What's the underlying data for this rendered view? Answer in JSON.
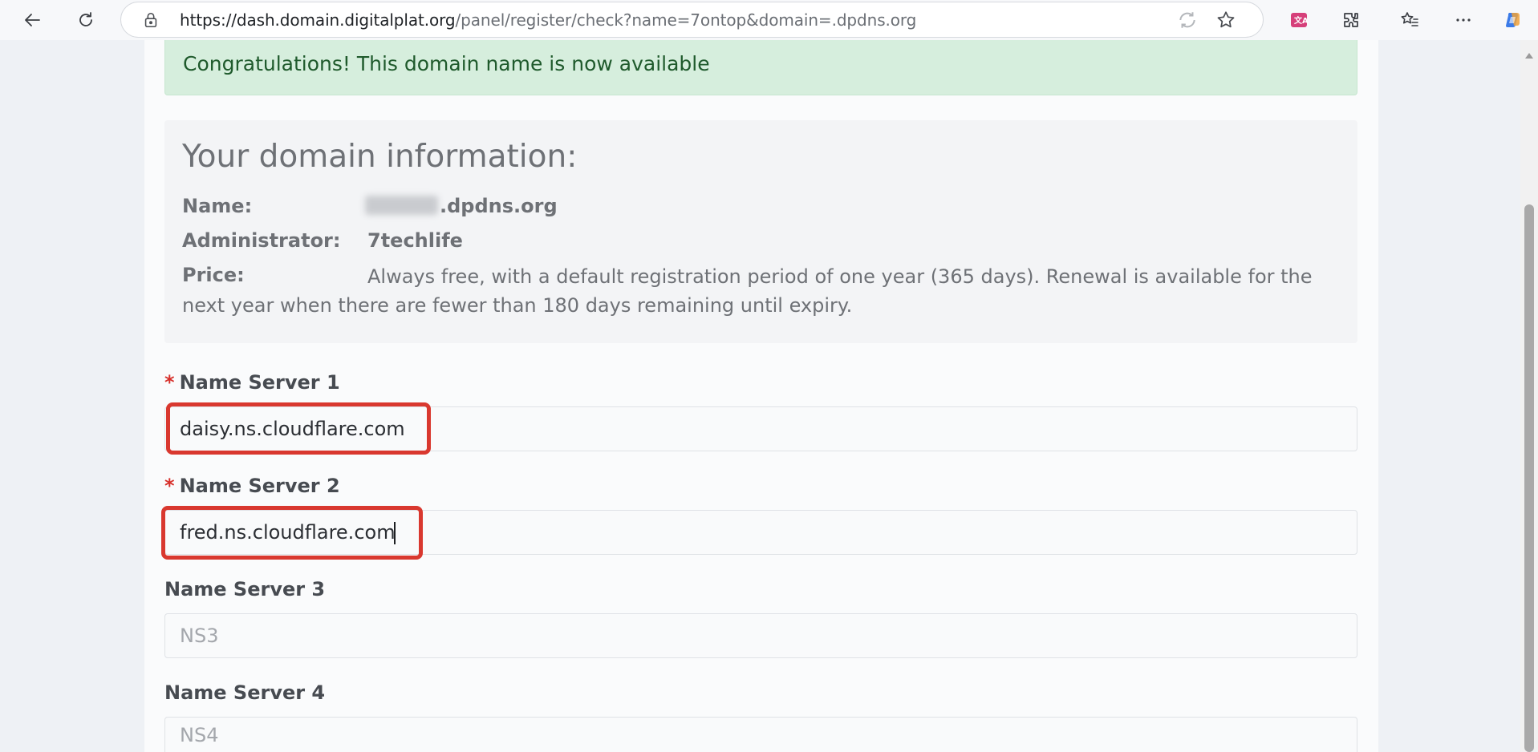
{
  "browser": {
    "url_host": "https://dash.domain.digitalplat.org",
    "url_path": "/panel/register/check?name=7ontop&domain=.dpdns.org",
    "icons": [
      "back-icon",
      "refresh-icon",
      "lock-icon",
      "tracking-prevention-icon",
      "favorite-star-icon",
      "translate-icon",
      "extensions-icon",
      "favorites-list-icon",
      "more-icon",
      "copilot-icon"
    ]
  },
  "alert": {
    "message": "Congratulations! This domain name is now available"
  },
  "domain_info": {
    "title": "Your domain information:",
    "name_label": "Name:",
    "name_suffix": ".dpdns.org",
    "admin_label": "Administrator:",
    "admin_value": "7techlife",
    "price_label": "Price:",
    "price_value": "Always free, with a default registration period of one year (365 days). Renewal is available for the next year when there are fewer than 180 days remaining until expiry."
  },
  "name_servers": {
    "required_mark": "*",
    "ns1_label": "Name Server 1",
    "ns1_value": "daisy.ns.cloudflare.com",
    "ns2_label": "Name Server 2",
    "ns2_value": "fred.ns.cloudflare.com",
    "ns3_label": "Name Server 3",
    "ns3_placeholder": "NS3",
    "ns4_label": "Name Server 4",
    "ns4_placeholder": "NS4"
  },
  "colors": {
    "success_bg": "#d6eedd",
    "success_text": "#1f5a2c",
    "highlight": "#d9382f",
    "required": "#d7302b"
  }
}
